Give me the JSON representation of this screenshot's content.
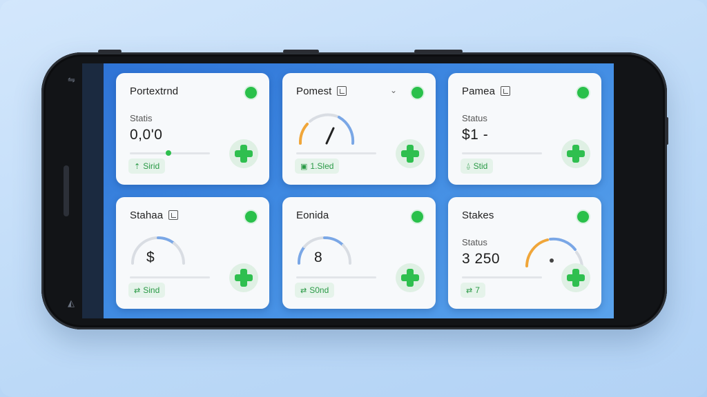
{
  "cards": [
    {
      "title": "Portextrnd",
      "status_label": "Statis",
      "value": "0,0'0",
      "chip": "Sirid",
      "chip_icon": "tree-icon",
      "status_color": "#29c04a"
    },
    {
      "title": "Pomest",
      "chip": "1.Sled",
      "chip_icon": "calendar-icon",
      "gauge_level": 0.55,
      "status_color": "#29c04a"
    },
    {
      "title": "Pamea",
      "status_label": "Status",
      "value": "$1 -",
      "chip": "Stid",
      "chip_icon": "triangle-icon",
      "status_color": "#29c04a"
    },
    {
      "title": "Stahaa",
      "gauge_center": "$",
      "chip": "Sind",
      "chip_icon": "branch-icon",
      "gauge_level": 0.3,
      "status_color": "#29c04a"
    },
    {
      "title": "Eonida",
      "gauge_center": "8",
      "chip": "S0nd",
      "chip_icon": "branch-icon",
      "gauge_level": 0.35,
      "status_color": "#29c04a"
    },
    {
      "title": "Stakes",
      "status_label": "Status",
      "value": "3 250",
      "chip": "7",
      "chip_icon": "branch-icon",
      "gauge_level": 0.7,
      "status_color": "#29c04a"
    }
  ],
  "colors": {
    "accent_green": "#2fbf4f",
    "gauge_blue": "#7aa7e6",
    "gauge_orange": "#f0a63a",
    "screen_blue": "#3f8ae2"
  }
}
